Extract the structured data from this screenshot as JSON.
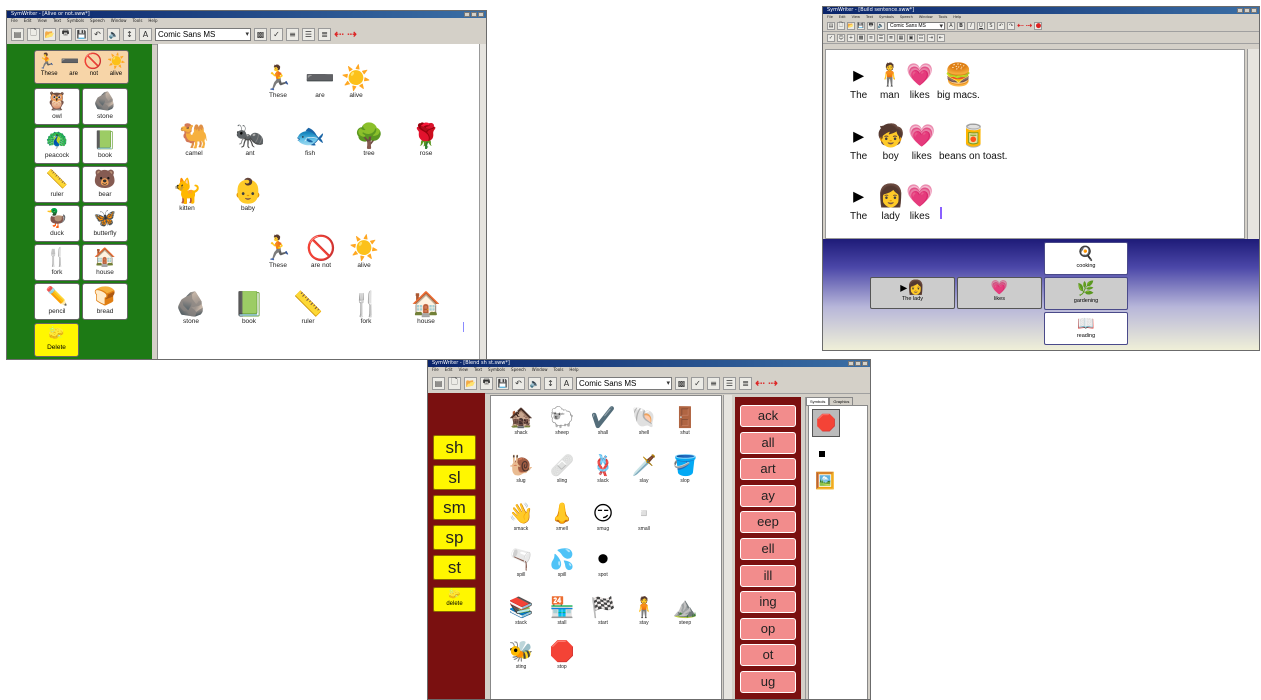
{
  "w1": {
    "title": "SymWriter - [Alive or not.sww*]",
    "menu": [
      "File",
      "Edit",
      "View",
      "Text",
      "Symbols",
      "Speech",
      "Window",
      "Tools",
      "Help"
    ],
    "font": "Comic Sans MS",
    "grid_header": {
      "words": [
        "These",
        "are",
        "not",
        "alive"
      ],
      "icons": [
        "running-person",
        "dash",
        "no-sign",
        "sun"
      ]
    },
    "grid": [
      {
        "label": "owl",
        "icon": "🦉"
      },
      {
        "label": "stone",
        "icon": "🪨"
      },
      {
        "label": "peacock",
        "icon": "🦚"
      },
      {
        "label": "book",
        "icon": "📗"
      },
      {
        "label": "ruler",
        "icon": "📏"
      },
      {
        "label": "bear",
        "icon": "🐻"
      },
      {
        "label": "duck",
        "icon": "🦆"
      },
      {
        "label": "butterfly",
        "icon": "🦋"
      },
      {
        "label": "fork",
        "icon": "🍴"
      },
      {
        "label": "house",
        "icon": "🏠"
      },
      {
        "label": "pencil",
        "icon": "✏️"
      },
      {
        "label": "bread",
        "icon": "🍞"
      }
    ],
    "delete_label": "Delete",
    "doc": {
      "row1_words": [
        "These",
        "are",
        "alive"
      ],
      "row1_icons": [
        "🏃",
        "➖",
        "☀️"
      ],
      "row2": [
        {
          "label": "camel",
          "icon": "🐫"
        },
        {
          "label": "ant",
          "icon": "🐜"
        },
        {
          "label": "fish",
          "icon": "🐟"
        },
        {
          "label": "tree",
          "icon": "🌳"
        },
        {
          "label": "rose",
          "icon": "🌹"
        }
      ],
      "row3": [
        {
          "label": "kitten",
          "icon": "🐈"
        },
        {
          "label": "baby",
          "icon": "👶"
        }
      ],
      "row4_words": [
        "These",
        "are not",
        "alive"
      ],
      "row4_icons": [
        "🏃",
        "🚫",
        "☀️"
      ],
      "row5": [
        {
          "label": "stone",
          "icon": "🪨"
        },
        {
          "label": "book",
          "icon": "📗"
        },
        {
          "label": "ruler",
          "icon": "📏"
        },
        {
          "label": "fork",
          "icon": "🍴"
        },
        {
          "label": "house",
          "icon": "🏠"
        }
      ]
    }
  },
  "w2": {
    "title": "SymWriter - [Build sentence.sww*]",
    "menu": [
      "File",
      "Edit",
      "View",
      "Text",
      "Symbols",
      "Speech",
      "Window",
      "Tools",
      "Help"
    ],
    "font": "Comic Sans MS",
    "lines": [
      [
        {
          "w": "The",
          "i": "▸"
        },
        {
          "w": "man",
          "i": "🧍"
        },
        {
          "w": "likes",
          "i": "💗"
        },
        {
          "w": "big macs.",
          "i": "🍔"
        }
      ],
      [
        {
          "w": "The",
          "i": "▸"
        },
        {
          "w": "boy",
          "i": "🧒"
        },
        {
          "w": "likes",
          "i": "💗"
        },
        {
          "w": "beans on toast.",
          "i": "🥫"
        }
      ],
      [
        {
          "w": "The",
          "i": "▸"
        },
        {
          "w": "lady",
          "i": "👩"
        },
        {
          "w": "likes",
          "i": "💗"
        }
      ]
    ],
    "strip": {
      "btn1": "The lady",
      "btn2": "likes",
      "choices": [
        {
          "label": "cooking",
          "icon": "🍳"
        },
        {
          "label": "gardening",
          "icon": "🌿"
        },
        {
          "label": "reading",
          "icon": "📖"
        }
      ]
    }
  },
  "w3": {
    "title": "SymWriter - [Blend sh st.sww*]",
    "menu": [
      "File",
      "Edit",
      "View",
      "Text",
      "Symbols",
      "Speech",
      "Window",
      "Tools",
      "Help"
    ],
    "font": "Comic Sans MS",
    "blends": [
      "sh",
      "sl",
      "sm",
      "sp",
      "st"
    ],
    "delete_label": "delete",
    "endings": [
      "ack",
      "all",
      "art",
      "ay",
      "eep",
      "ell",
      "ill",
      "ing",
      "op",
      "ot",
      "ug"
    ],
    "panel_tabs": [
      "Symbols",
      "Graphics"
    ],
    "doc_rows": [
      [
        {
          "l": "shack",
          "i": "🏚️"
        },
        {
          "l": "sheep",
          "i": "🐑"
        },
        {
          "l": "shall",
          "i": "✔️"
        },
        {
          "l": "shell",
          "i": "🐚"
        },
        {
          "l": "shut",
          "i": "🚪"
        }
      ],
      [
        {
          "l": "slug",
          "i": "🐌"
        },
        {
          "l": "sling",
          "i": "🩹"
        },
        {
          "l": "slack",
          "i": "🪢"
        },
        {
          "l": "slay",
          "i": "🗡️"
        },
        {
          "l": "slop",
          "i": "🪣"
        }
      ],
      [
        {
          "l": "smack",
          "i": "👋"
        },
        {
          "l": "smell",
          "i": "👃"
        },
        {
          "l": "smug",
          "i": "😏"
        },
        {
          "l": "small",
          "i": "▫️"
        }
      ],
      [
        {
          "l": "spill",
          "i": "🫗"
        },
        {
          "l": "spill",
          "i": "💦"
        },
        {
          "l": "spot",
          "i": "⚫"
        }
      ],
      [
        {
          "l": "stack",
          "i": "📚"
        },
        {
          "l": "stall",
          "i": "🏪"
        },
        {
          "l": "start",
          "i": "🏁"
        },
        {
          "l": "stay",
          "i": "🧍"
        },
        {
          "l": "steep",
          "i": "⛰️"
        }
      ],
      [
        {
          "l": "sting",
          "i": "🐝"
        },
        {
          "l": "stop",
          "i": "🛑"
        }
      ]
    ]
  }
}
